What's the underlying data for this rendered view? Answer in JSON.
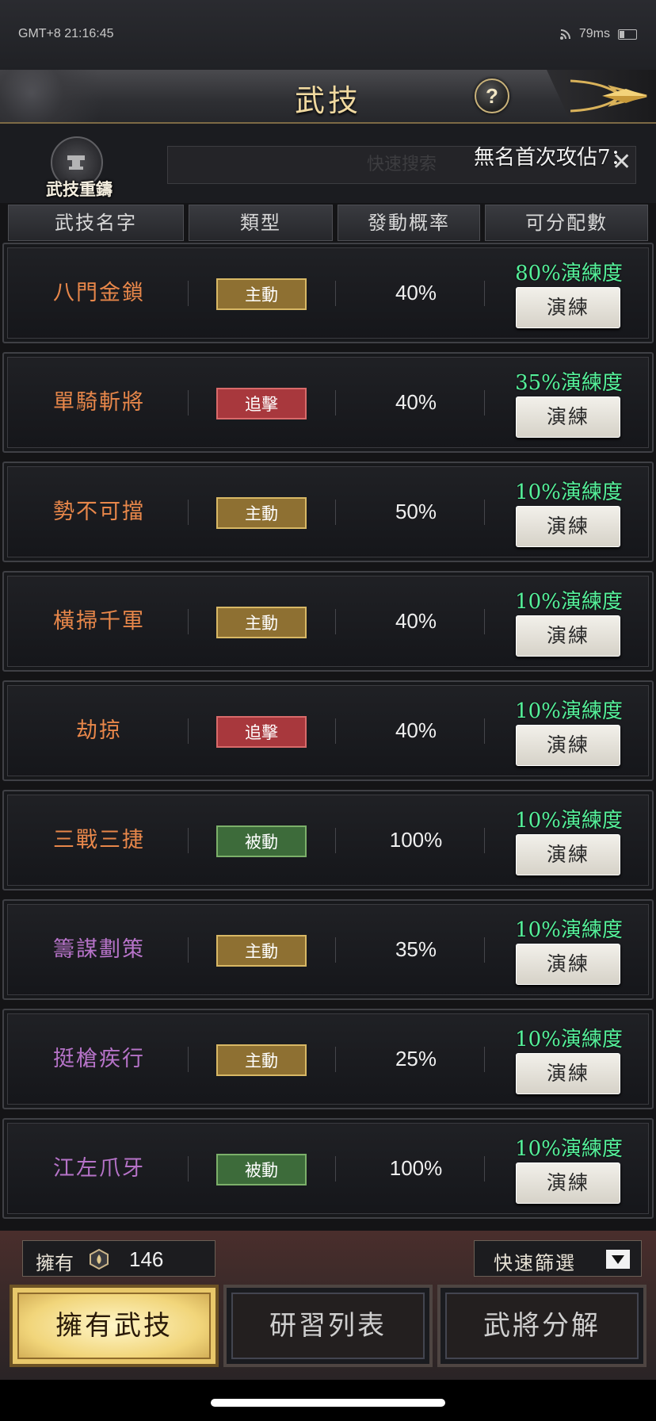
{
  "status_bar": {
    "time": "GMT+8 21:16:45",
    "ping": "79ms"
  },
  "header": {
    "title": "武技",
    "help": "?"
  },
  "quick_panel": {
    "recast_label": "武技重鑄",
    "search_placeholder": "快速搜索",
    "announcement": "無名首次攻佔7："
  },
  "columns": [
    "武技名字",
    "類型",
    "發動概率",
    "可分配數"
  ],
  "colors": {
    "active_type": "#8e7032",
    "chase_type": "#a8383d",
    "passive_type": "#3d6b3a",
    "orange_name": "#e8874a",
    "purple_name": "#b673c8",
    "proficiency": "#55f09a"
  },
  "skills": [
    {
      "name": "八門金鎖",
      "name_color": "#e8874a",
      "type": "主動",
      "type_color": "#8e7032",
      "type_border": "#d8b865",
      "rate": "40%",
      "proficiency": "80%演練度",
      "action": "演練"
    },
    {
      "name": "單騎斬將",
      "name_color": "#e8874a",
      "type": "追擊",
      "type_color": "#a8383d",
      "type_border": "#d86a6a",
      "rate": "40%",
      "proficiency": "35%演練度",
      "action": "演練"
    },
    {
      "name": "勢不可擋",
      "name_color": "#e8874a",
      "type": "主動",
      "type_color": "#8e7032",
      "type_border": "#d8b865",
      "rate": "50%",
      "proficiency": "10%演練度",
      "action": "演練"
    },
    {
      "name": "橫掃千軍",
      "name_color": "#e8874a",
      "type": "主動",
      "type_color": "#8e7032",
      "type_border": "#d8b865",
      "rate": "40%",
      "proficiency": "10%演練度",
      "action": "演練"
    },
    {
      "name": "劫掠",
      "name_color": "#e8874a",
      "type": "追擊",
      "type_color": "#a8383d",
      "type_border": "#d86a6a",
      "rate": "40%",
      "proficiency": "10%演練度",
      "action": "演練"
    },
    {
      "name": "三戰三捷",
      "name_color": "#e8874a",
      "type": "被動",
      "type_color": "#3d6b3a",
      "type_border": "#7cb06a",
      "rate": "100%",
      "proficiency": "10%演練度",
      "action": "演練"
    },
    {
      "name": "籌謀劃策",
      "name_color": "#b673c8",
      "type": "主動",
      "type_color": "#8e7032",
      "type_border": "#d8b865",
      "rate": "35%",
      "proficiency": "10%演練度",
      "action": "演練"
    },
    {
      "name": "挺槍疾行",
      "name_color": "#b673c8",
      "type": "主動",
      "type_color": "#8e7032",
      "type_border": "#d8b865",
      "rate": "25%",
      "proficiency": "10%演練度",
      "action": "演練"
    },
    {
      "name": "江左爪牙",
      "name_color": "#b673c8",
      "type": "被動",
      "type_color": "#3d6b3a",
      "type_border": "#7cb06a",
      "rate": "100%",
      "proficiency": "10%演練度",
      "action": "演練"
    }
  ],
  "footer": {
    "owned_label": "擁有",
    "owned_count": "146",
    "filter_label": "快速篩選",
    "tabs": [
      {
        "label": "擁有武技",
        "active": true
      },
      {
        "label": "研習列表",
        "active": false
      },
      {
        "label": "武將分解",
        "active": false
      }
    ]
  }
}
